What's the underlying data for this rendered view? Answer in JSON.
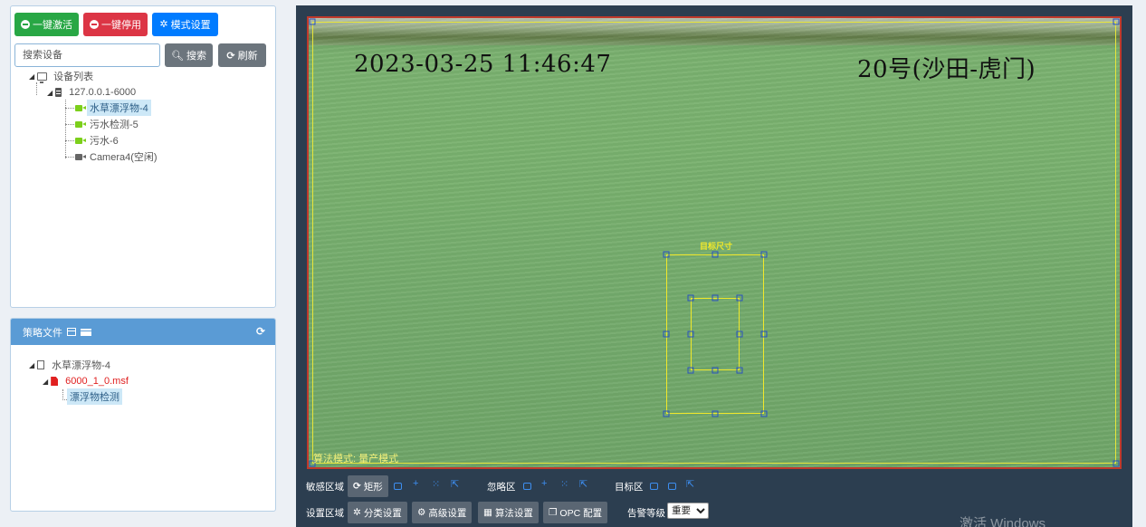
{
  "top_buttons": {
    "activate_all": "一键激活",
    "disable_all": "一键停用",
    "mode_settings": "模式设置"
  },
  "search": {
    "placeholder": "搜索设备",
    "search_label": "搜索",
    "refresh_label": "刷新"
  },
  "device_tree": {
    "root": "设备列表",
    "server": "127.0.0.1-6000",
    "cameras": [
      {
        "label": "水草漂浮物-4",
        "selected": true,
        "active": true
      },
      {
        "label": "污水检测-5",
        "selected": false,
        "active": true
      },
      {
        "label": "污水-6",
        "selected": false,
        "active": true
      },
      {
        "label": "Camera4(空闲)",
        "selected": false,
        "active": false
      }
    ]
  },
  "strategy_panel": {
    "title": "策略文件",
    "tree": {
      "root": "水草漂浮物-4",
      "file": "6000_1_0.msf",
      "item": "漂浮物检测"
    }
  },
  "video": {
    "timestamp": "2023-03-25  11:46:47",
    "channel": "20号(沙田-虎门)",
    "mode": "算法模式: 量产模式",
    "target_label": "目标尺寸"
  },
  "toolbar": {
    "sensitive_area": "敏感区域",
    "rect_button": "矩形",
    "ignore_area": "忽略区",
    "target_area": "目标区",
    "set_area": "设置区域",
    "classify_settings": "分类设置",
    "advanced_settings": "高级设置",
    "algorithm_settings": "算法设置",
    "opc_config": "OPC 配置",
    "alarm_level_label": "告警等级",
    "alarm_level_value": "重要"
  },
  "watermark": "激活 Windows",
  "colors": {
    "green": "#28a745",
    "red": "#dc3545",
    "blue": "#007bff",
    "gray": "#6c757d",
    "panel_header": "#5a9bd5",
    "video_bg": "#2c3e50",
    "zone_outline": "#e8e53a",
    "handle": "#2a52be"
  }
}
